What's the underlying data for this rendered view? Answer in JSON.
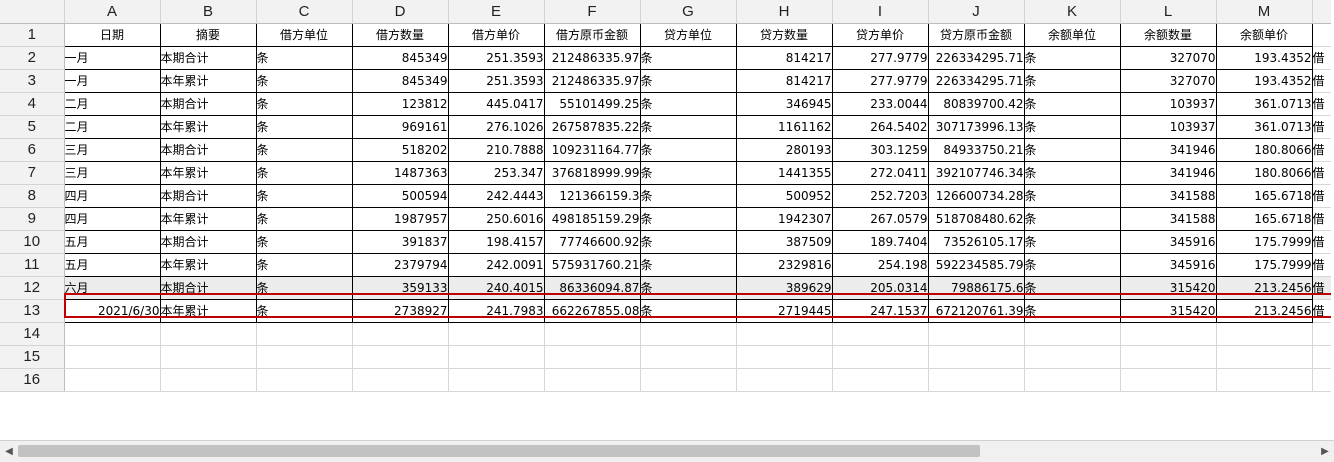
{
  "columns": [
    "A",
    "B",
    "C",
    "D",
    "E",
    "F",
    "G",
    "H",
    "I",
    "J",
    "K",
    "L",
    "M"
  ],
  "rows": [
    {
      "n": "1",
      "cells": [
        "日期",
        "摘要",
        "借方单位",
        "借方数量",
        "借方单价",
        "借方原币金额",
        "贷方单位",
        "贷方数量",
        "贷方单价",
        "贷方原币金额",
        "余额单位",
        "余额数量",
        "余额单价"
      ],
      "extra": ""
    },
    {
      "n": "2",
      "cells": [
        "一月",
        "本期合计",
        "条",
        "845349",
        "251.3593",
        "212486335.97",
        "条",
        "814217",
        "277.9779",
        "226334295.71",
        "条",
        "327070",
        "193.4352"
      ],
      "extra": "借"
    },
    {
      "n": "3",
      "cells": [
        "一月",
        "本年累计",
        "条",
        "845349",
        "251.3593",
        "212486335.97",
        "条",
        "814217",
        "277.9779",
        "226334295.71",
        "条",
        "327070",
        "193.4352"
      ],
      "extra": "借"
    },
    {
      "n": "4",
      "cells": [
        "二月",
        "本期合计",
        "条",
        "123812",
        "445.0417",
        "55101499.25",
        "条",
        "346945",
        "233.0044",
        "80839700.42",
        "条",
        "103937",
        "361.0713"
      ],
      "extra": "借"
    },
    {
      "n": "5",
      "cells": [
        "二月",
        "本年累计",
        "条",
        "969161",
        "276.1026",
        "267587835.22",
        "条",
        "1161162",
        "264.5402",
        "307173996.13",
        "条",
        "103937",
        "361.0713"
      ],
      "extra": "借"
    },
    {
      "n": "6",
      "cells": [
        "三月",
        "本期合计",
        "条",
        "518202",
        "210.7888",
        "109231164.77",
        "条",
        "280193",
        "303.1259",
        "84933750.21",
        "条",
        "341946",
        "180.8066"
      ],
      "extra": "借"
    },
    {
      "n": "7",
      "cells": [
        "三月",
        "本年累计",
        "条",
        "1487363",
        "253.347",
        "376818999.99",
        "条",
        "1441355",
        "272.0411",
        "392107746.34",
        "条",
        "341946",
        "180.8066"
      ],
      "extra": "借"
    },
    {
      "n": "8",
      "cells": [
        "四月",
        "本期合计",
        "条",
        "500594",
        "242.4443",
        "121366159.3",
        "条",
        "500952",
        "252.7203",
        "126600734.28",
        "条",
        "341588",
        "165.6718"
      ],
      "extra": "借"
    },
    {
      "n": "9",
      "cells": [
        "四月",
        "本年累计",
        "条",
        "1987957",
        "250.6016",
        "498185159.29",
        "条",
        "1942307",
        "267.0579",
        "518708480.62",
        "条",
        "341588",
        "165.6718"
      ],
      "extra": "借"
    },
    {
      "n": "10",
      "cells": [
        "五月",
        "本期合计",
        "条",
        "391837",
        "198.4157",
        "77746600.92",
        "条",
        "387509",
        "189.7404",
        "73526105.17",
        "条",
        "345916",
        "175.7999"
      ],
      "extra": "借"
    },
    {
      "n": "11",
      "cells": [
        "五月",
        "本年累计",
        "条",
        "2379794",
        "242.0091",
        "575931760.21",
        "条",
        "2329816",
        "254.198",
        "592234585.79",
        "条",
        "345916",
        "175.7999"
      ],
      "extra": "借"
    },
    {
      "n": "12",
      "cells": [
        "六月",
        "本期合计",
        "条",
        "359133",
        "240.4015",
        "86336094.87",
        "条",
        "389629",
        "205.0314",
        "79886175.6",
        "条",
        "315420",
        "213.2456"
      ],
      "extra": "借"
    },
    {
      "n": "13",
      "cells": [
        "2021/6/30",
        "本年累计",
        "条",
        "2738927",
        "241.7983",
        "662267855.08",
        "条",
        "2719445",
        "247.1537",
        "672120761.39",
        "条",
        "315420",
        "213.2456"
      ],
      "extra": "借"
    },
    {
      "n": "14",
      "cells": [
        "",
        "",
        "",
        "",
        "",
        "",
        "",
        "",
        "",
        "",
        "",
        "",
        ""
      ],
      "extra": ""
    },
    {
      "n": "15",
      "cells": [
        "",
        "",
        "",
        "",
        "",
        "",
        "",
        "",
        "",
        "",
        "",
        "",
        ""
      ],
      "extra": ""
    },
    {
      "n": "16",
      "cells": [
        "",
        "",
        "",
        "",
        "",
        "",
        "",
        "",
        "",
        "",
        "",
        "",
        ""
      ],
      "extra": ""
    }
  ],
  "colors": {
    "selection": "#c00000",
    "header_bg": "#f2f2f2"
  }
}
